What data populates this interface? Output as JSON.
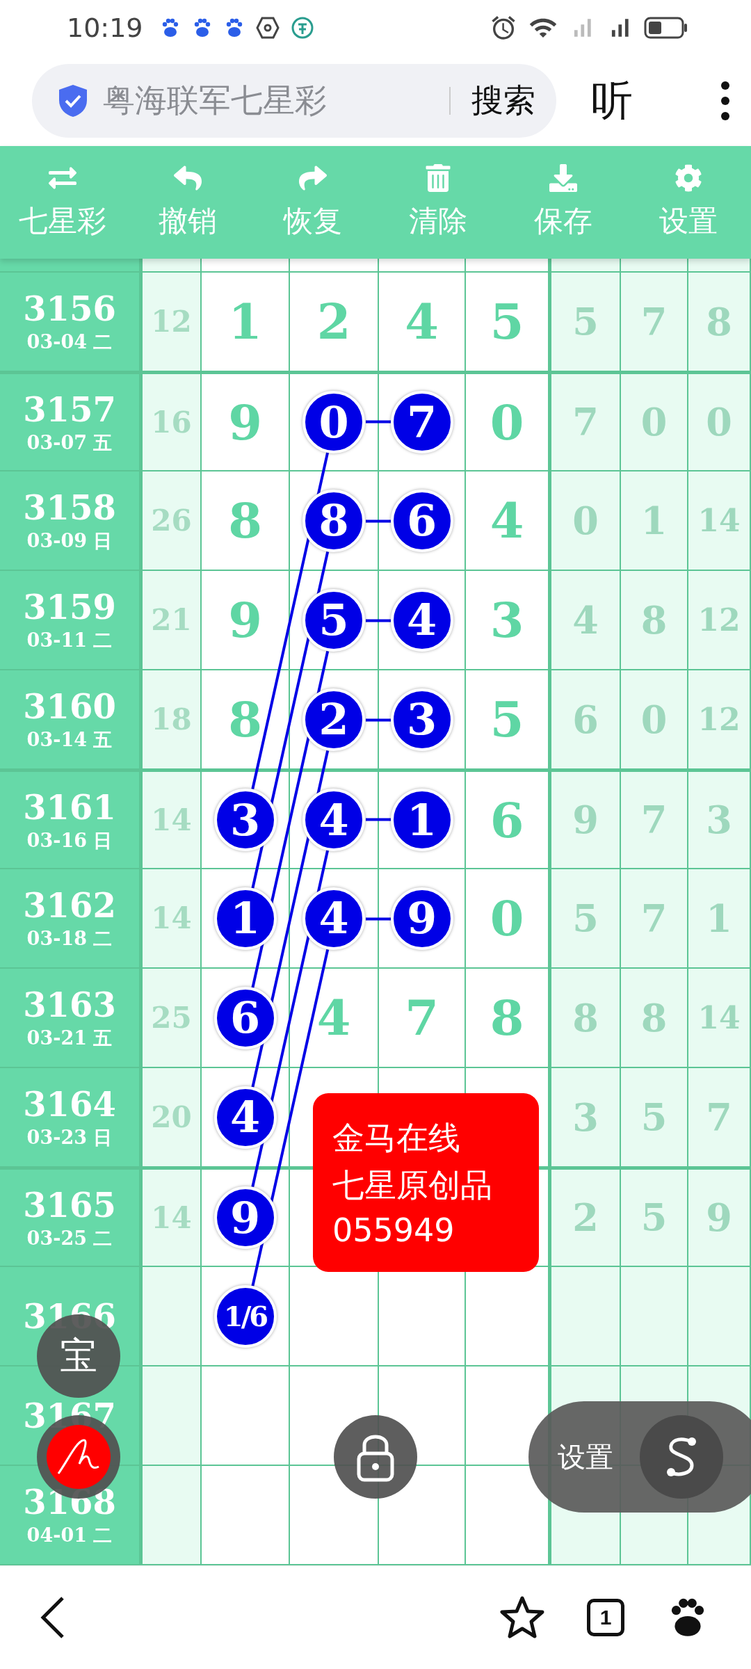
{
  "status_bar": {
    "time": "10:19"
  },
  "address_bar": {
    "query": "粤海联军七星彩",
    "search_button": "搜索",
    "listen_button": "听"
  },
  "toolbar": [
    {
      "kind": "swap",
      "label": "七星彩"
    },
    {
      "kind": "undo",
      "label": "撤销"
    },
    {
      "kind": "redo",
      "label": "恢复"
    },
    {
      "kind": "clear",
      "label": "清除"
    },
    {
      "kind": "save",
      "label": "保存"
    },
    {
      "kind": "settings",
      "label": "设置"
    }
  ],
  "grid": {
    "rows": [
      {
        "issue": "3156",
        "date": "03-04 二",
        "sum": "12",
        "cells": [
          {
            "kind": "plain",
            "value": "1"
          },
          {
            "kind": "plain",
            "value": "2"
          },
          {
            "kind": "plain",
            "value": "4"
          },
          {
            "kind": "plain",
            "value": "5"
          }
        ],
        "tail": [
          "5",
          "7",
          "8"
        ]
      },
      {
        "issue": "3157",
        "date": "03-07 五",
        "sum": "16",
        "cells": [
          {
            "kind": "plain",
            "value": "9"
          },
          {
            "kind": "ball",
            "value": "0"
          },
          {
            "kind": "ball",
            "value": "7"
          },
          {
            "kind": "plain",
            "value": "0"
          }
        ],
        "tail": [
          "7",
          "0",
          "0"
        ]
      },
      {
        "issue": "3158",
        "date": "03-09 日",
        "sum": "26",
        "cells": [
          {
            "kind": "plain",
            "value": "8"
          },
          {
            "kind": "ball",
            "value": "8"
          },
          {
            "kind": "ball",
            "value": "6"
          },
          {
            "kind": "plain",
            "value": "4"
          }
        ],
        "tail": [
          "0",
          "1",
          "14"
        ]
      },
      {
        "issue": "3159",
        "date": "03-11 二",
        "sum": "21",
        "cells": [
          {
            "kind": "plain",
            "value": "9"
          },
          {
            "kind": "ball",
            "value": "5"
          },
          {
            "kind": "ball",
            "value": "4"
          },
          {
            "kind": "plain",
            "value": "3"
          }
        ],
        "tail": [
          "4",
          "8",
          "12"
        ]
      },
      {
        "issue": "3160",
        "date": "03-14 五",
        "sum": "18",
        "cells": [
          {
            "kind": "plain",
            "value": "8"
          },
          {
            "kind": "ball",
            "value": "2"
          },
          {
            "kind": "ball",
            "value": "3"
          },
          {
            "kind": "plain",
            "value": "5"
          }
        ],
        "tail": [
          "6",
          "0",
          "12"
        ]
      },
      {
        "issue": "3161",
        "date": "03-16 日",
        "sum": "14",
        "cells": [
          {
            "kind": "ball",
            "value": "3"
          },
          {
            "kind": "ball",
            "value": "4"
          },
          {
            "kind": "ball",
            "value": "1"
          },
          {
            "kind": "plain",
            "value": "6"
          }
        ],
        "tail": [
          "9",
          "7",
          "3"
        ]
      },
      {
        "issue": "3162",
        "date": "03-18 二",
        "sum": "14",
        "cells": [
          {
            "kind": "ball",
            "value": "1"
          },
          {
            "kind": "ball",
            "value": "4"
          },
          {
            "kind": "ball",
            "value": "9"
          },
          {
            "kind": "plain",
            "value": "0"
          }
        ],
        "tail": [
          "5",
          "7",
          "1"
        ]
      },
      {
        "issue": "3163",
        "date": "03-21 五",
        "sum": "25",
        "cells": [
          {
            "kind": "ball",
            "value": "6"
          },
          {
            "kind": "plain",
            "value": "4"
          },
          {
            "kind": "plain",
            "value": "7"
          },
          {
            "kind": "plain",
            "value": "8"
          }
        ],
        "tail": [
          "8",
          "8",
          "14"
        ]
      },
      {
        "issue": "3164",
        "date": "03-23 日",
        "sum": "20",
        "cells": [
          {
            "kind": "ball",
            "value": "4"
          },
          {
            "kind": "blank"
          },
          {
            "kind": "blank"
          },
          {
            "kind": "blank"
          }
        ],
        "tail": [
          "3",
          "5",
          "7"
        ]
      },
      {
        "issue": "3165",
        "date": "03-25 二",
        "sum": "14",
        "cells": [
          {
            "kind": "ball",
            "value": "9"
          },
          {
            "kind": "blank"
          },
          {
            "kind": "blank"
          },
          {
            "kind": "blank"
          }
        ],
        "tail": [
          "2",
          "5",
          "9"
        ]
      },
      {
        "issue": "3166",
        "cells": [
          {
            "kind": "ball",
            "value": "1/6"
          },
          {
            "kind": "blank"
          },
          {
            "kind": "blank"
          },
          {
            "kind": "blank"
          }
        ]
      },
      {
        "issue": "3167",
        "cells": [
          {
            "kind": "blank"
          },
          {
            "kind": "blank"
          },
          {
            "kind": "blank"
          },
          {
            "kind": "blank"
          }
        ]
      },
      {
        "issue": "3168",
        "date": "04-01 二",
        "cells": [
          {
            "kind": "blank"
          },
          {
            "kind": "blank"
          },
          {
            "kind": "blank"
          },
          {
            "kind": "blank"
          }
        ]
      }
    ]
  },
  "note": {
    "lines": [
      "金马在线",
      "七星原创品",
      "055949"
    ]
  },
  "floating": {
    "treasure_button": "宝",
    "settings_label": "设置"
  },
  "bottom_nav": {
    "tab_count": "1"
  }
}
